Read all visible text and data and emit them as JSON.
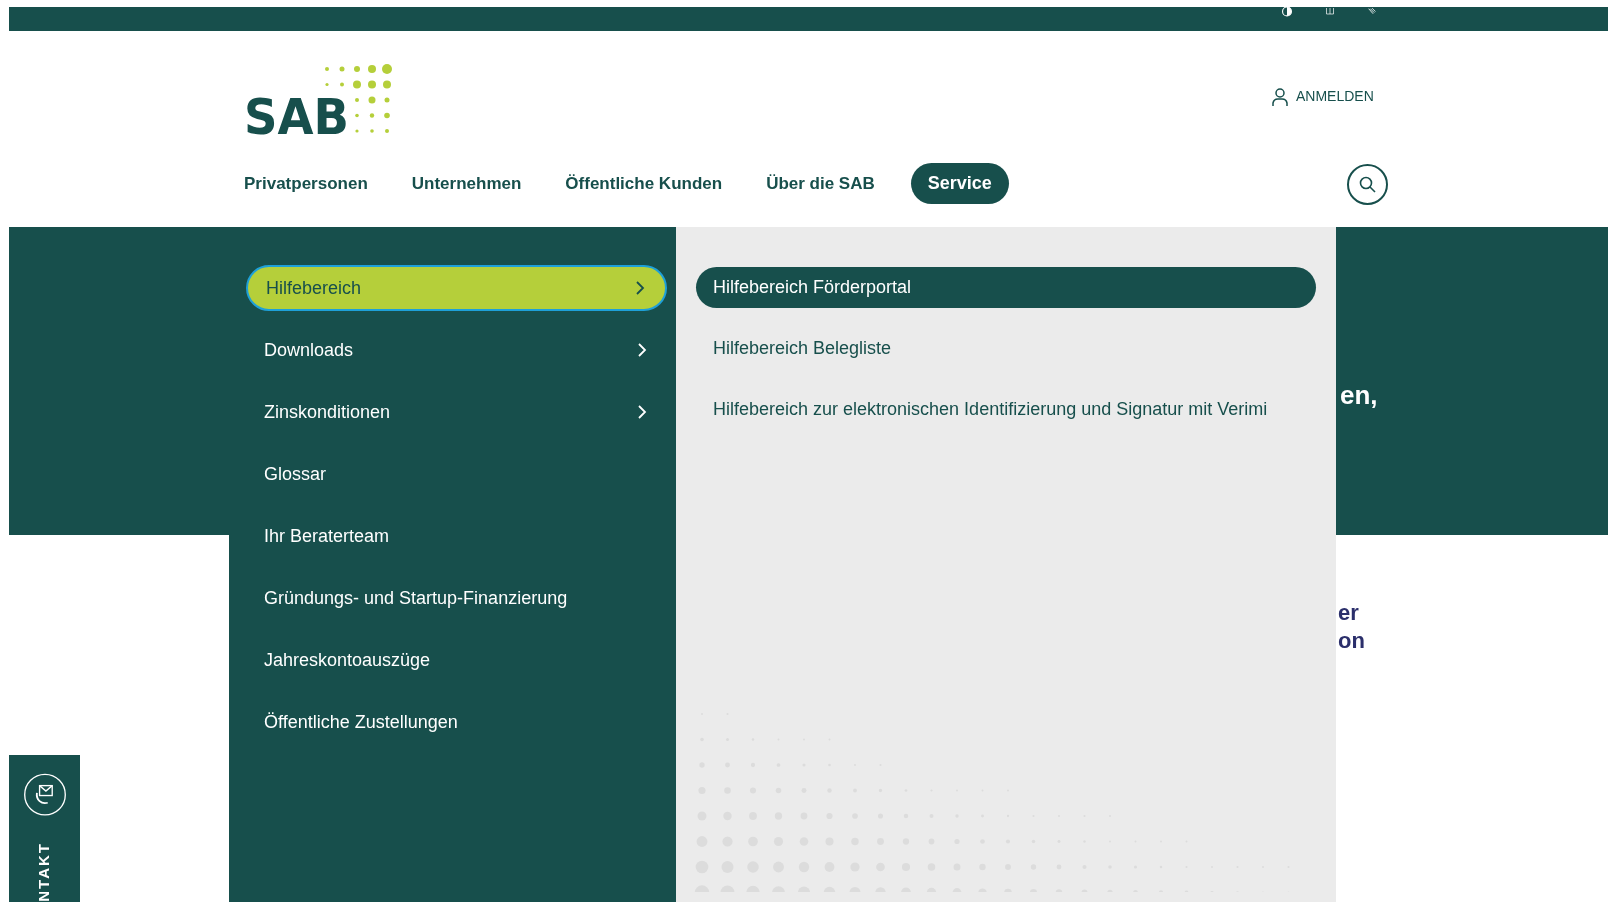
{
  "header": {
    "logo": "SAB",
    "login": "ANMELDEN"
  },
  "nav": [
    {
      "label": "Privatpersonen",
      "selected": false
    },
    {
      "label": "Unternehmen",
      "selected": false
    },
    {
      "label": "Öffentliche Kunden",
      "selected": false
    },
    {
      "label": "Über die SAB",
      "selected": false
    },
    {
      "label": "Service",
      "selected": true
    }
  ],
  "menu": [
    {
      "label": "Hilfebereich",
      "has_submenu": true,
      "selected": true
    },
    {
      "label": "Downloads",
      "has_submenu": true,
      "selected": false
    },
    {
      "label": "Zinskonditionen",
      "has_submenu": true,
      "selected": false
    },
    {
      "label": "Glossar",
      "has_submenu": false,
      "selected": false
    },
    {
      "label": "Ihr Beraterteam",
      "has_submenu": false,
      "selected": false
    },
    {
      "label": "Gründungs- und Startup-Finanzierung",
      "has_submenu": false,
      "selected": false
    },
    {
      "label": "Jahreskontoauszüge",
      "has_submenu": false,
      "selected": false
    },
    {
      "label": "Öffentliche Zustellungen",
      "has_submenu": false,
      "selected": false
    }
  ],
  "submenu": [
    {
      "label": "Hilfebereich Förderportal",
      "selected": true
    },
    {
      "label": "Hilfebereich Belegliste",
      "selected": false
    },
    {
      "label": "Hilfebereich zur elektronischen Identifizierung und Signatur mit Verimi",
      "selected": false
    }
  ],
  "background_text": {
    "hero": "en,",
    "body_line_1": "er",
    "body_line_2": "on"
  },
  "contact_tab": {
    "label": "NTAKT"
  }
}
